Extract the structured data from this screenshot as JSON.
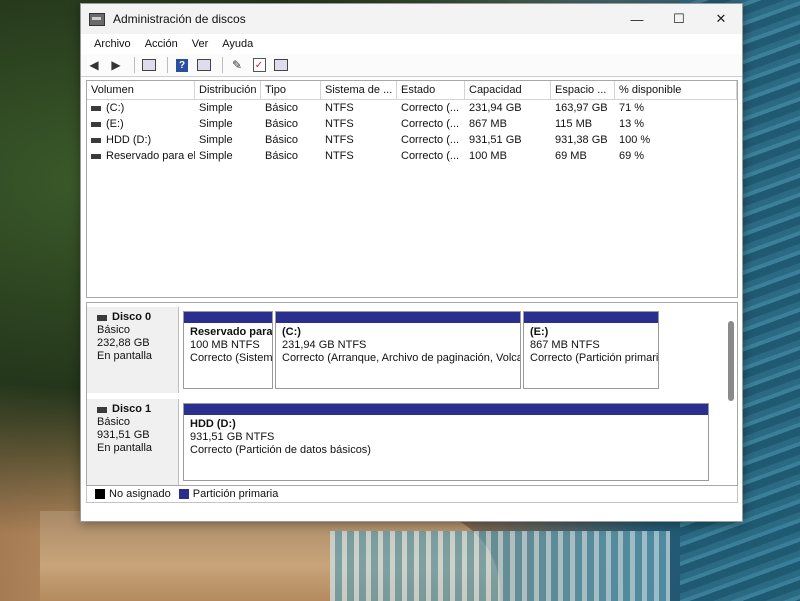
{
  "window": {
    "title": "Administración de discos",
    "minimize": "—",
    "maximize": "☐",
    "close": "✕"
  },
  "menu": [
    "Archivo",
    "Acción",
    "Ver",
    "Ayuda"
  ],
  "colors": {
    "primary_partition": "#2a2f8f",
    "unallocated": "#000000"
  },
  "toolbar_icons": [
    "back-arrow-icon",
    "forward-arrow-icon",
    "properties-icon",
    "help-icon",
    "list-view-icon",
    "connect-icon",
    "check-icon",
    "view-icon"
  ],
  "volume_table": {
    "columns": [
      "Volumen",
      "Distribución",
      "Tipo",
      "Sistema de ...",
      "Estado",
      "Capacidad",
      "Espacio ...",
      "% disponible"
    ],
    "rows": [
      [
        "(C:)",
        "Simple",
        "Básico",
        "NTFS",
        "Correcto (...",
        "231,94 GB",
        "163,97 GB",
        "71 %"
      ],
      [
        "(E:)",
        "Simple",
        "Básico",
        "NTFS",
        "Correcto (...",
        "867 MB",
        "115 MB",
        "13 %"
      ],
      [
        "HDD (D:)",
        "Simple",
        "Básico",
        "NTFS",
        "Correcto (...",
        "931,51 GB",
        "931,38 GB",
        "100 %"
      ],
      [
        "Reservado para el...",
        "Simple",
        "Básico",
        "NTFS",
        "Correcto (...",
        "100 MB",
        "69 MB",
        "69 %"
      ]
    ]
  },
  "disks": [
    {
      "name": "Disco 0",
      "type": "Básico",
      "size": "232,88 GB",
      "status": "En pantalla",
      "partitions": [
        {
          "name": "Reservado para",
          "size": "100 MB NTFS",
          "status": "Correcto (Sistema"
        },
        {
          "name": "(C:)",
          "size": "231,94 GB NTFS",
          "status": "Correcto (Arranque, Archivo de paginación, Volcado"
        },
        {
          "name": "(E:)",
          "size": "867 MB NTFS",
          "status": "Correcto (Partición primaria"
        }
      ]
    },
    {
      "name": "Disco 1",
      "type": "Básico",
      "size": "931,51 GB",
      "status": "En pantalla",
      "partitions": [
        {
          "name": "HDD  (D:)",
          "size": "931,51 GB NTFS",
          "status": "Correcto (Partición de datos básicos)"
        }
      ]
    }
  ],
  "legend": {
    "unallocated": "No asignado",
    "primary": "Partición primaria"
  }
}
